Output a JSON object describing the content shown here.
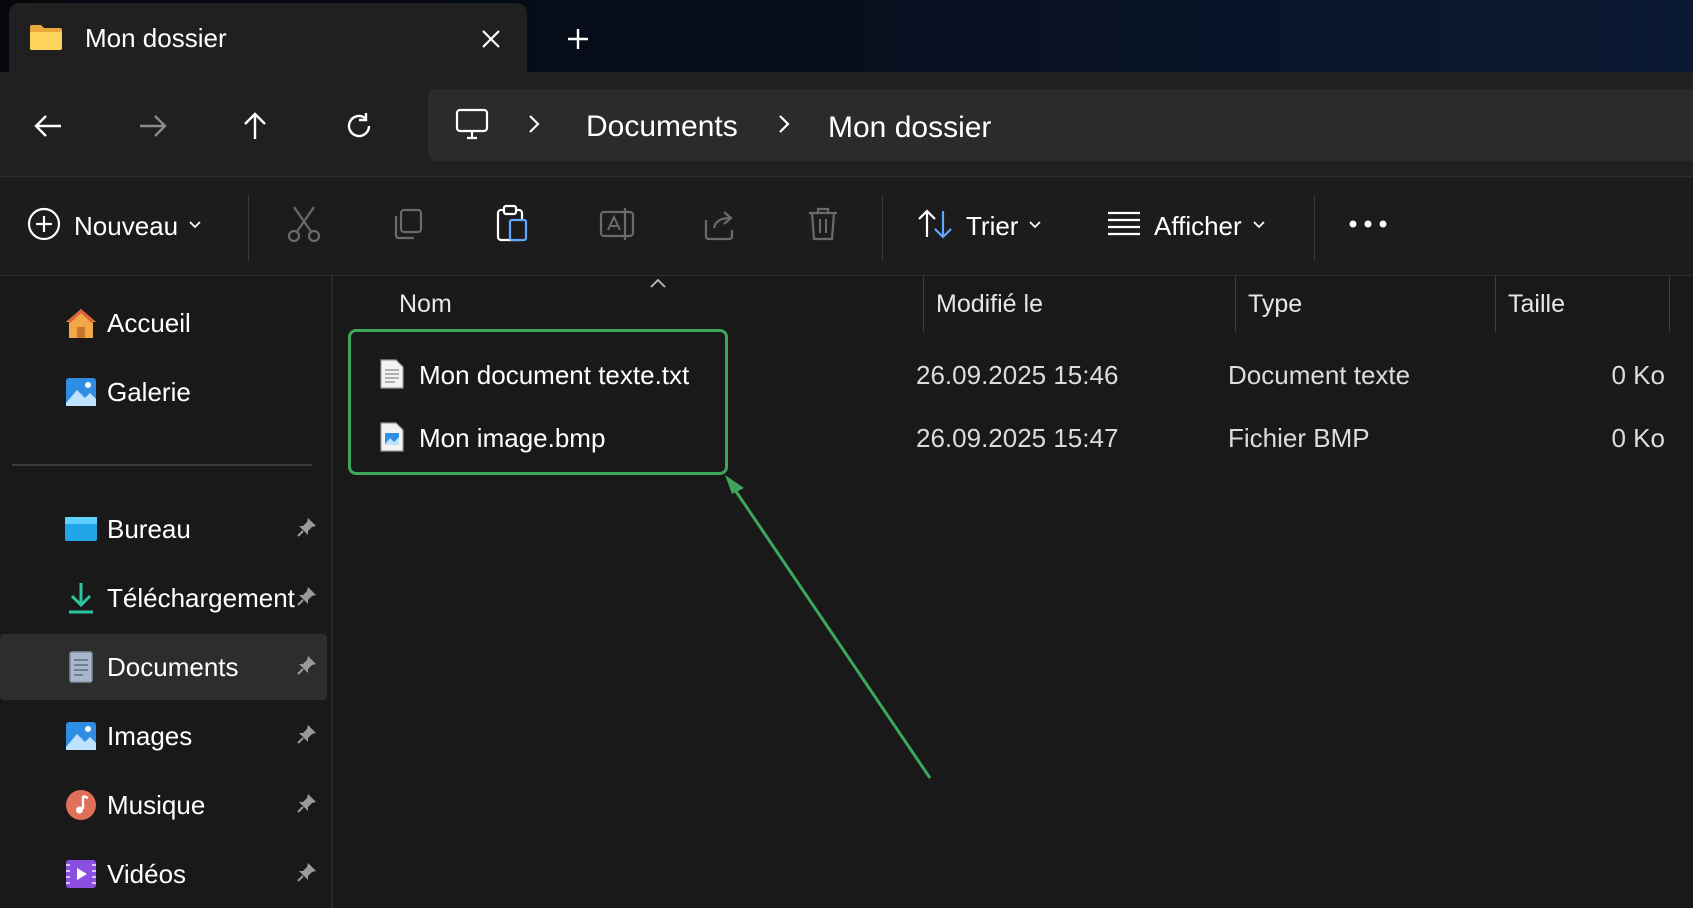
{
  "tab": {
    "title": "Mon dossier"
  },
  "breadcrumb": {
    "items": [
      "Documents",
      "Mon dossier"
    ]
  },
  "toolbar": {
    "new_label": "Nouveau",
    "sort_label": "Trier",
    "view_label": "Afficher"
  },
  "sidebar": {
    "items": [
      {
        "label": "Accueil",
        "icon": "home-icon",
        "pinned": false
      },
      {
        "label": "Galerie",
        "icon": "gallery-icon",
        "pinned": false
      },
      {
        "label": "Bureau",
        "icon": "desktop-icon",
        "pinned": true
      },
      {
        "label": "Téléchargement",
        "icon": "download-icon",
        "pinned": true
      },
      {
        "label": "Documents",
        "icon": "documents-icon",
        "pinned": true,
        "selected": true
      },
      {
        "label": "Images",
        "icon": "pictures-icon",
        "pinned": true
      },
      {
        "label": "Musique",
        "icon": "music-icon",
        "pinned": true
      },
      {
        "label": "Vidéos",
        "icon": "videos-icon",
        "pinned": true
      }
    ]
  },
  "columns": {
    "name": "Nom",
    "modified": "Modifié le",
    "type": "Type",
    "size": "Taille"
  },
  "files": [
    {
      "name": "Mon document texte.txt",
      "modified": "26.09.2025 15:46",
      "type": "Document texte",
      "size": "0 Ko",
      "icon": "text-file-icon"
    },
    {
      "name": "Mon image.bmp",
      "modified": "26.09.2025 15:47",
      "type": "Fichier BMP",
      "size": "0 Ko",
      "icon": "image-file-icon"
    }
  ],
  "colors": {
    "accent_highlight": "#3ea55c",
    "background": "#191919",
    "selected_sidebar": "#2d2d2d"
  }
}
